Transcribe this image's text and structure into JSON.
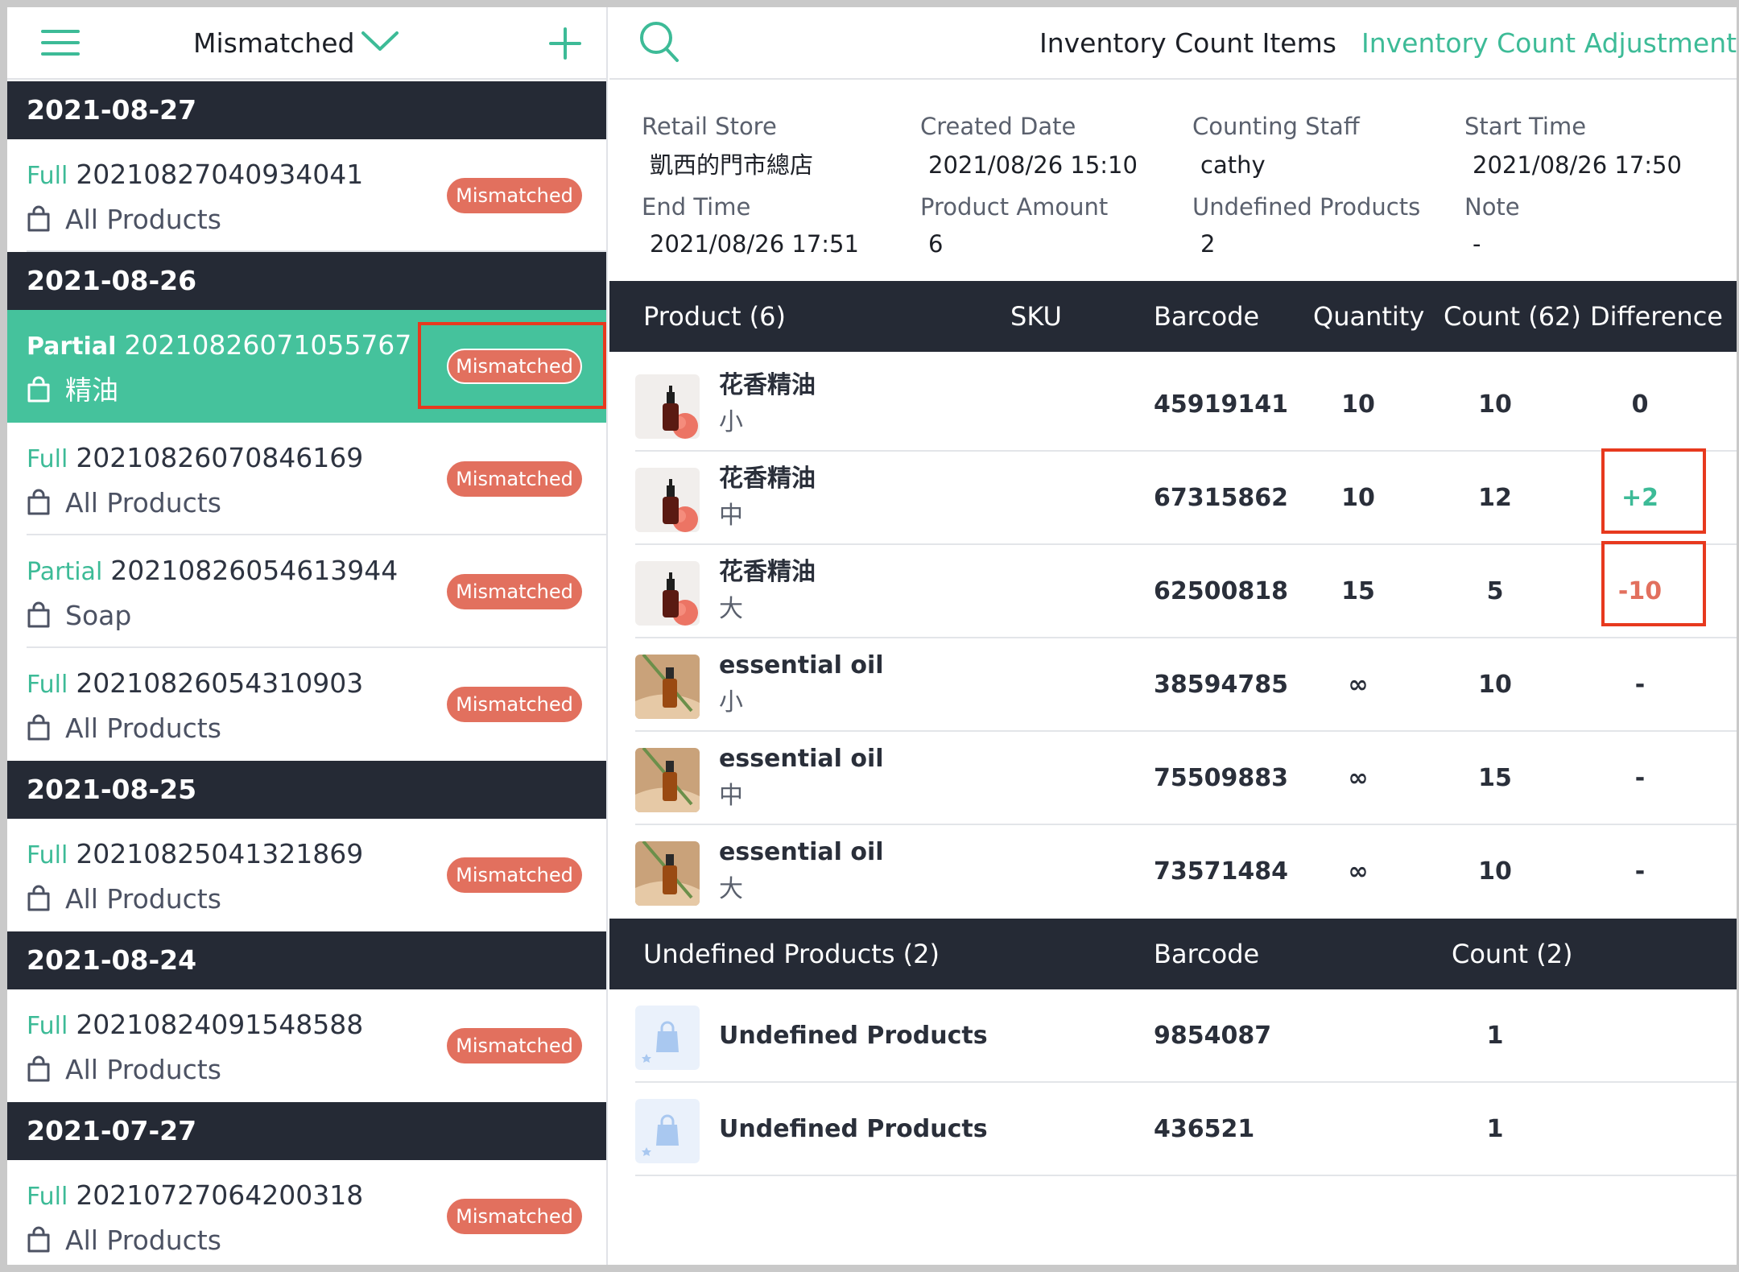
{
  "left_header": {
    "filter_label": "Mismatched",
    "menu_icon": "hamburger-menu-icon",
    "dropdown_icon": "chevron-down-icon",
    "add_icon": "plus-icon"
  },
  "groups": [
    {
      "date": "2021-08-27"
    },
    {
      "date": "2021-08-26"
    },
    {
      "date": "2021-08-25"
    },
    {
      "date": "2021-08-24"
    },
    {
      "date": "2021-07-27"
    }
  ],
  "records": [
    {
      "type": "Full",
      "id": "20210827040934041",
      "scope": "All Products",
      "status": "Mismatched"
    },
    {
      "type": "Partial",
      "id": "20210826071055767",
      "scope": "精油",
      "status": "Mismatched",
      "selected": true
    },
    {
      "type": "Full",
      "id": "20210826070846169",
      "scope": "All Products",
      "status": "Mismatched"
    },
    {
      "type": "Partial",
      "id": "20210826054613944",
      "scope": "Soap",
      "status": "Mismatched"
    },
    {
      "type": "Full",
      "id": "20210826054310903",
      "scope": "All Products",
      "status": "Mismatched"
    },
    {
      "type": "Full",
      "id": "20210825041321869",
      "scope": "All Products",
      "status": "Mismatched"
    },
    {
      "type": "Full",
      "id": "20210824091548588",
      "scope": "All Products",
      "status": "Mismatched"
    },
    {
      "type": "Full",
      "id": "20210727064200318",
      "scope": "All Products",
      "status": "Mismatched"
    }
  ],
  "right_header": {
    "search_icon": "search-icon",
    "tab_items": "Inventory Count Items",
    "tab_adjustment": "Inventory Count Adjustment"
  },
  "info": {
    "retail_store_label": "Retail Store",
    "retail_store": "凱西的門市總店",
    "created_date_label": "Created Date",
    "created_date": "2021/08/26 15:10",
    "counting_staff_label": "Counting Staff",
    "counting_staff": "cathy",
    "start_time_label": "Start Time",
    "start_time": "2021/08/26 17:50",
    "end_time_label": "End Time",
    "end_time": "2021/08/26 17:51",
    "product_amount_label": "Product Amount",
    "product_amount": "6",
    "undefined_products_label": "Undefined Products",
    "undefined_products": "2",
    "note_label": "Note",
    "note": "-"
  },
  "products_table": {
    "headers": {
      "product": "Product (6)",
      "sku": "SKU",
      "barcode": "Barcode",
      "quantity": "Quantity",
      "count": "Count (62)",
      "difference": "Difference"
    },
    "rows": [
      {
        "name": "花香精油",
        "variant": "小",
        "sku": "",
        "barcode": "45919141",
        "quantity": "10",
        "count": "10",
        "difference": "0",
        "thumb": "rose-oil"
      },
      {
        "name": "花香精油",
        "variant": "中",
        "sku": "",
        "barcode": "67315862",
        "quantity": "10",
        "count": "12",
        "difference": "+2",
        "thumb": "rose-oil"
      },
      {
        "name": "花香精油",
        "variant": "大",
        "sku": "",
        "barcode": "62500818",
        "quantity": "15",
        "count": "5",
        "difference": "-10",
        "thumb": "rose-oil"
      },
      {
        "name": "essential oil",
        "variant": "小",
        "sku": "",
        "barcode": "38594785",
        "quantity": "∞",
        "count": "10",
        "difference": "-",
        "thumb": "amber-oil"
      },
      {
        "name": "essential oil",
        "variant": "中",
        "sku": "",
        "barcode": "75509883",
        "quantity": "∞",
        "count": "15",
        "difference": "-",
        "thumb": "amber-oil"
      },
      {
        "name": "essential oil",
        "variant": "大",
        "sku": "",
        "barcode": "73571484",
        "quantity": "∞",
        "count": "10",
        "difference": "-",
        "thumb": "amber-oil"
      }
    ]
  },
  "undefined_table": {
    "headers": {
      "product": "Undefined Products (2)",
      "barcode": "Barcode",
      "count": "Count (2)"
    },
    "rows": [
      {
        "name": "Undefined Products",
        "barcode": "9854087",
        "count": "1"
      },
      {
        "name": "Undefined Products",
        "barcode": "436521",
        "count": "1"
      }
    ]
  },
  "colors": {
    "accent_green": "#3dbb97",
    "selected_row": "#45c29c",
    "badge_red": "#e2705e",
    "header_dark": "#252a35",
    "highlight_red": "#e7391e"
  }
}
